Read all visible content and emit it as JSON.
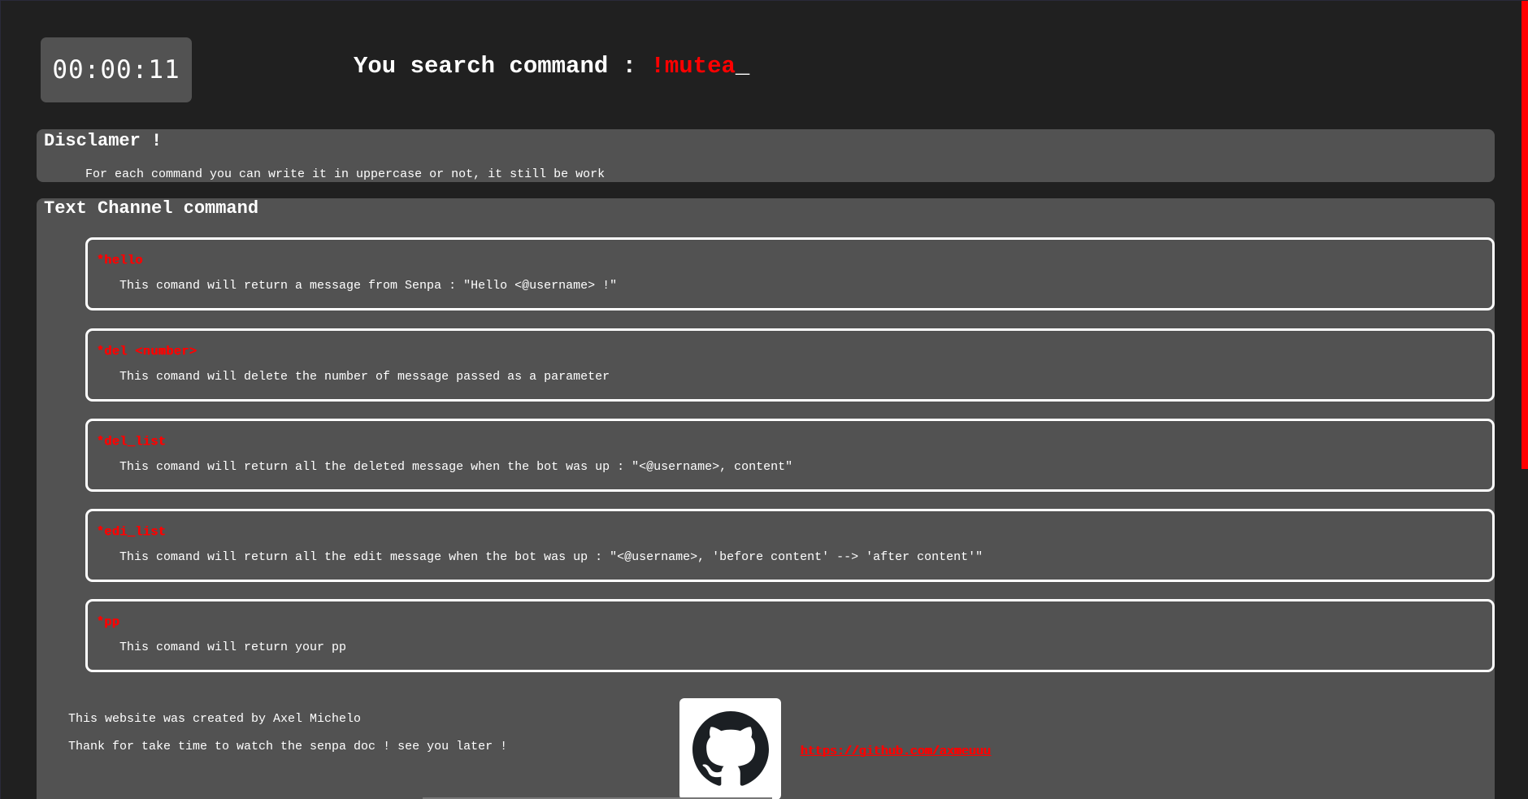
{
  "timer": {
    "value": "00:00:11"
  },
  "search": {
    "label": "You search command : ",
    "term": "!mutea",
    "caret": "_"
  },
  "disclaimer": {
    "title": "Disclamer !",
    "text": "For each command you can write it in uppercase or not, it still be work"
  },
  "text_channel": {
    "title": "Text Channel command",
    "commands": [
      {
        "name": "*hello",
        "desc": "This comand will return a message from Senpa : \"Hello <@username> !\""
      },
      {
        "name": "*del <number>",
        "desc": "This comand will delete the number of message passed as a parameter"
      },
      {
        "name": "*del_list",
        "desc": "This comand will return all the deleted message when the bot was up : \"<@username>, content\""
      },
      {
        "name": "*edi_list",
        "desc": "This comand will return all the edit message when the bot was up : \"<@username>, 'before content' --> 'after content'\""
      },
      {
        "name": "*pp",
        "desc": "This comand will return your pp"
      }
    ]
  },
  "footer": {
    "line1": "This website was created by Axel Michelo",
    "line2": "Thank for take time to watch the senpa doc ! see you later !",
    "github_icon": "github-icon",
    "link": "https://github.com/axmeuuu"
  },
  "colors": {
    "background": "#202020",
    "panel": "#525252",
    "accent": "#ff0000",
    "text": "#ffffff"
  }
}
